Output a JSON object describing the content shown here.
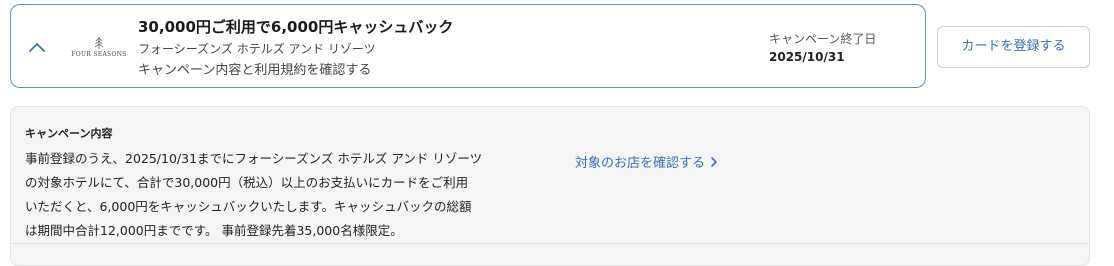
{
  "offer": {
    "title": "30,000円ご利用で6,000円キャッシュバック",
    "merchant": "フォーシーズンズ ホテルズ アンド リゾーツ",
    "terms_link": "キャンペーン内容と利用規約を確認する",
    "logo_text": "FOUR SEASONS",
    "end_label": "キャンペーン終了日",
    "end_date": "2025/10/31",
    "register_button": "カードを登録する",
    "toggle_icon": "chevron-up-icon",
    "accent_color": "#3a6fbd",
    "border_color": "#5b8fd6"
  },
  "details": {
    "heading": "キャンペーン内容",
    "body_lines": [
      "事前登録のうえ、2025/10/31までにフォーシーズンズ ホテルズ アンド リゾーツ",
      "の対象ホテルにて、合計で30,000円（税込）以上のお支払いにカードをご利用",
      "いただくと、6,000円をキャッシュバックいたします。キャッシュバックの総額",
      "は期間中合計12,000円までです。 事前登録先着35,000名様限定。"
    ],
    "stores_link": "対象のお店を確認する",
    "stores_link_icon": "chevron-right-icon",
    "panel_color": "#f5f5f5"
  }
}
